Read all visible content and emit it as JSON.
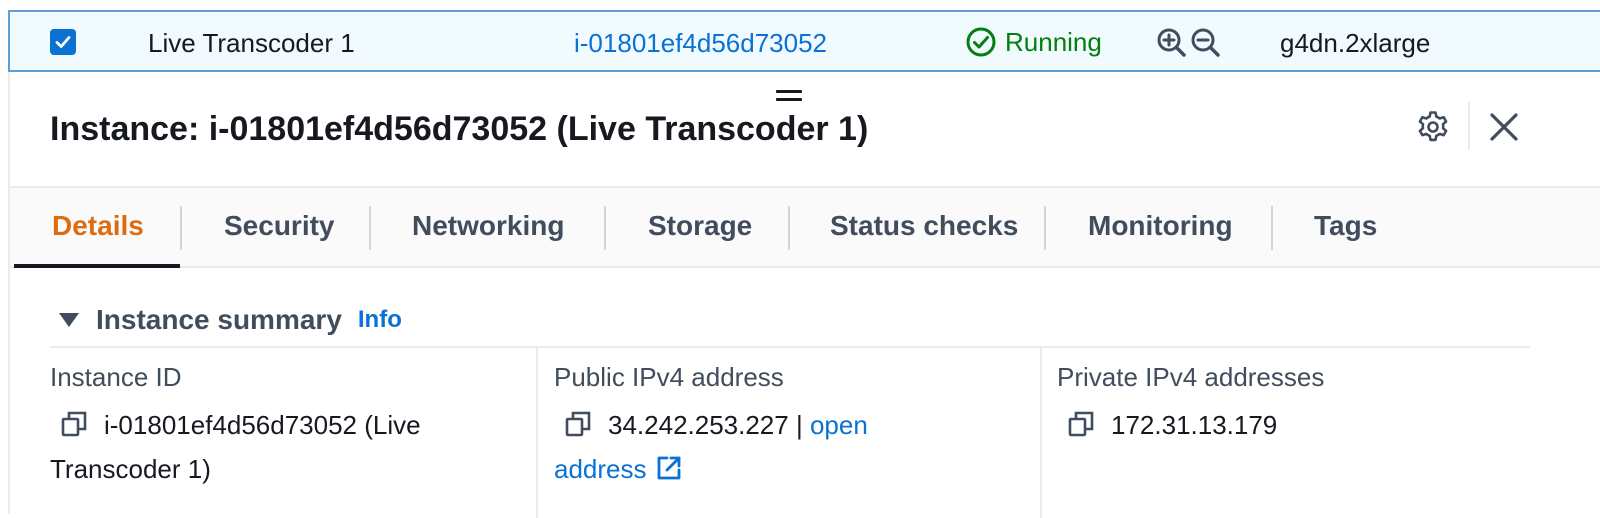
{
  "row": {
    "checked": true,
    "name": "Live Transcoder 1",
    "instance_id": "i-01801ef4d56d73052",
    "status": "Running",
    "instance_type": "g4dn.2xlarge"
  },
  "panel": {
    "title": "Instance: i-01801ef4d56d73052 (Live Transcoder 1)"
  },
  "tabs": [
    {
      "label": "Details",
      "active": true
    },
    {
      "label": "Security"
    },
    {
      "label": "Networking"
    },
    {
      "label": "Storage"
    },
    {
      "label": "Status checks"
    },
    {
      "label": "Monitoring"
    },
    {
      "label": "Tags"
    }
  ],
  "summary": {
    "title": "Instance summary",
    "info_label": "Info",
    "fields": {
      "instance_id": {
        "label": "Instance ID",
        "value_line1": "i-01801ef4d56d73052 (Live",
        "value_line2": "Transcoder 1)"
      },
      "public_ipv4": {
        "label": "Public IPv4 address",
        "value": "34.242.253.227",
        "separator": "|",
        "link_part1": "open",
        "link_part2": "address"
      },
      "private_ipv4": {
        "label": "Private IPv4 addresses",
        "value": "172.31.13.179"
      }
    }
  },
  "colors": {
    "link": "#0972d3",
    "running": "#037f0c",
    "active_tab": "#dd6b10",
    "selected_row_bg": "#f1faff",
    "selected_row_border": "#5f9fd6"
  },
  "icons": [
    "checkbox-checked-icon",
    "status-success-icon",
    "zoom-in-icon",
    "zoom-out-icon",
    "drag-handle-icon",
    "gear-icon",
    "close-icon",
    "caret-down-icon",
    "copy-icon",
    "external-link-icon"
  ]
}
